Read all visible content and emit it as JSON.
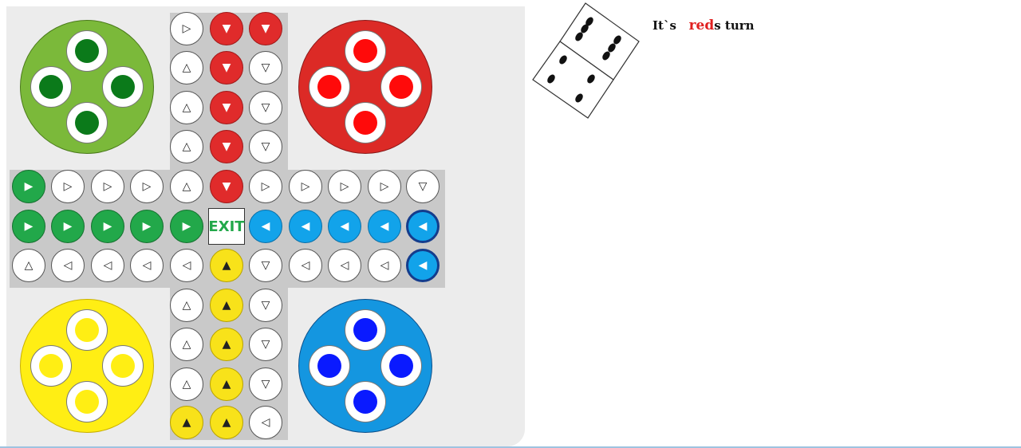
{
  "board": {
    "exit_label": "EXIT"
  },
  "homes": {
    "green": {
      "color": "#7bb93a",
      "piece_color": "#0b7a1a"
    },
    "red": {
      "color": "#dc2a26",
      "piece_color": "#ff0a0a"
    },
    "yellow": {
      "color": "#ffee14",
      "piece_color": "#ffee14"
    },
    "blue": {
      "color": "#1496e0",
      "piece_color": "#0a1aff"
    }
  },
  "colors": {
    "red": "#e02b2b",
    "green": "#22a84a",
    "blue": "#12a3ea",
    "yellow": "#f8e21a"
  },
  "dice": {
    "faces_shown": [
      4,
      6
    ]
  },
  "status": {
    "prefix": "It`s",
    "current_player": "red",
    "suffix": "s turn"
  }
}
